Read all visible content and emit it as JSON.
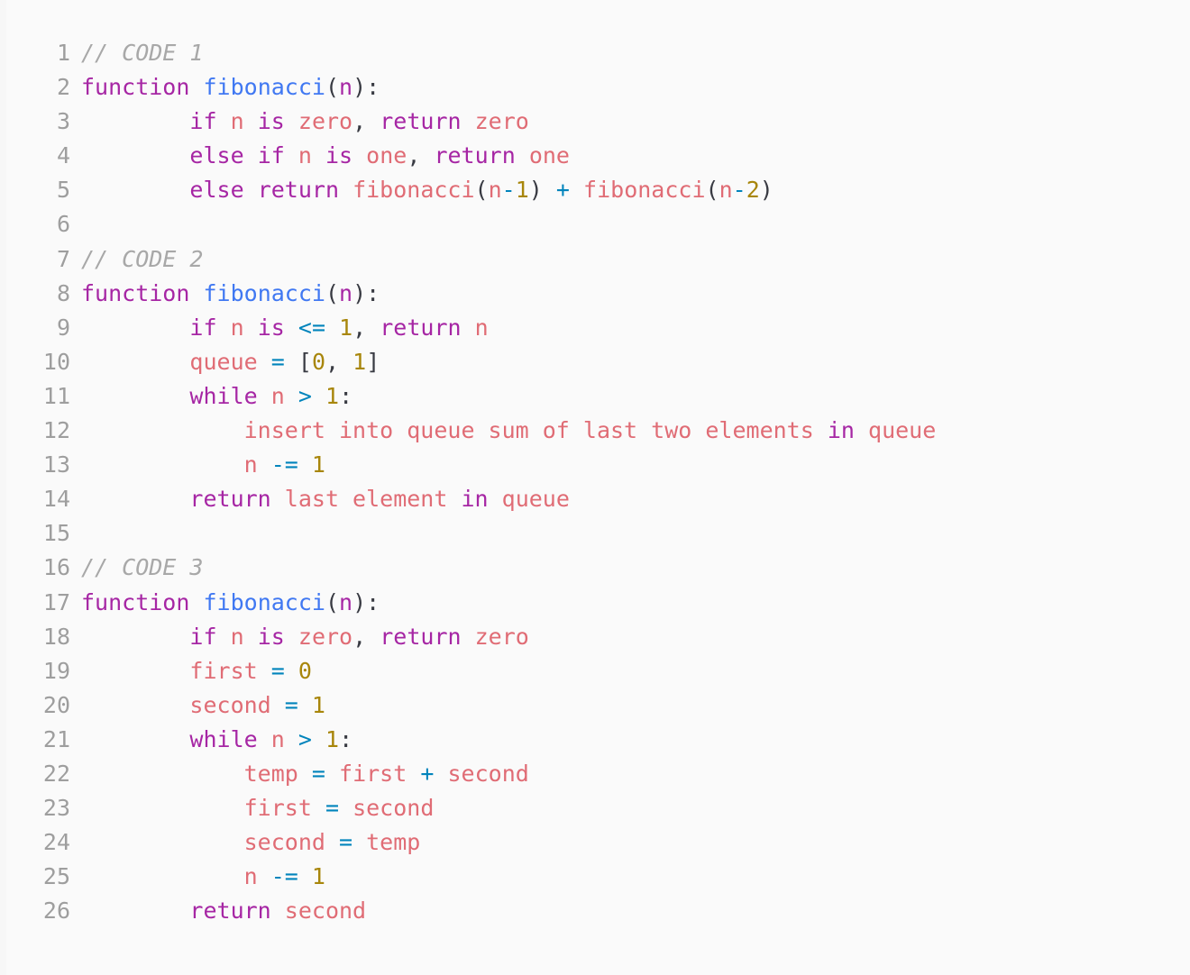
{
  "editor": {
    "background_color": "#fafafa",
    "gutter_color": "#9e9e9e",
    "font_size_px": 25,
    "total_lines": 26
  },
  "colors": {
    "comment": "#a8a8a8",
    "keyword": "#a626a4",
    "function_def": "#4078f2",
    "function_call": "#e06c75",
    "identifier": "#e06c75",
    "operator": "#0184bc",
    "number": "#a8860b",
    "punctuation": "#383a42"
  },
  "code": {
    "lines": [
      {
        "number": "1",
        "tokens": [
          {
            "t": "// CODE 1",
            "c": "comment"
          }
        ]
      },
      {
        "number": "2",
        "tokens": [
          {
            "t": "function",
            "c": "kw"
          },
          {
            "t": " ",
            "c": "plain"
          },
          {
            "t": "fibonacci",
            "c": "fndef"
          },
          {
            "t": "(",
            "c": "punct"
          },
          {
            "t": "n",
            "c": "kw"
          },
          {
            "t": ")",
            "c": "punct"
          },
          {
            "t": ":",
            "c": "punct"
          }
        ]
      },
      {
        "number": "3",
        "tokens": [
          {
            "t": "        ",
            "c": "plain"
          },
          {
            "t": "if",
            "c": "kw"
          },
          {
            "t": " ",
            "c": "plain"
          },
          {
            "t": "n",
            "c": "name"
          },
          {
            "t": " ",
            "c": "plain"
          },
          {
            "t": "is",
            "c": "kw"
          },
          {
            "t": " ",
            "c": "plain"
          },
          {
            "t": "zero",
            "c": "name"
          },
          {
            "t": ",",
            "c": "punct"
          },
          {
            "t": " ",
            "c": "plain"
          },
          {
            "t": "return",
            "c": "kw"
          },
          {
            "t": " ",
            "c": "plain"
          },
          {
            "t": "zero",
            "c": "name"
          }
        ]
      },
      {
        "number": "4",
        "tokens": [
          {
            "t": "        ",
            "c": "plain"
          },
          {
            "t": "else",
            "c": "kw"
          },
          {
            "t": " ",
            "c": "plain"
          },
          {
            "t": "if",
            "c": "kw"
          },
          {
            "t": " ",
            "c": "plain"
          },
          {
            "t": "n",
            "c": "name"
          },
          {
            "t": " ",
            "c": "plain"
          },
          {
            "t": "is",
            "c": "kw"
          },
          {
            "t": " ",
            "c": "plain"
          },
          {
            "t": "one",
            "c": "name"
          },
          {
            "t": ",",
            "c": "punct"
          },
          {
            "t": " ",
            "c": "plain"
          },
          {
            "t": "return",
            "c": "kw"
          },
          {
            "t": " ",
            "c": "plain"
          },
          {
            "t": "one",
            "c": "name"
          }
        ]
      },
      {
        "number": "5",
        "tokens": [
          {
            "t": "        ",
            "c": "plain"
          },
          {
            "t": "else",
            "c": "kw"
          },
          {
            "t": " ",
            "c": "plain"
          },
          {
            "t": "return",
            "c": "kw"
          },
          {
            "t": " ",
            "c": "plain"
          },
          {
            "t": "fibonacci",
            "c": "fncall"
          },
          {
            "t": "(",
            "c": "punct"
          },
          {
            "t": "n",
            "c": "name"
          },
          {
            "t": "-",
            "c": "op"
          },
          {
            "t": "1",
            "c": "num"
          },
          {
            "t": ")",
            "c": "punct"
          },
          {
            "t": " ",
            "c": "plain"
          },
          {
            "t": "+",
            "c": "op"
          },
          {
            "t": " ",
            "c": "plain"
          },
          {
            "t": "fibonacci",
            "c": "fncall"
          },
          {
            "t": "(",
            "c": "punct"
          },
          {
            "t": "n",
            "c": "name"
          },
          {
            "t": "-",
            "c": "op"
          },
          {
            "t": "2",
            "c": "num"
          },
          {
            "t": ")",
            "c": "punct"
          }
        ]
      },
      {
        "number": "6",
        "tokens": []
      },
      {
        "number": "7",
        "tokens": [
          {
            "t": "// CODE 2",
            "c": "comment"
          }
        ]
      },
      {
        "number": "8",
        "tokens": [
          {
            "t": "function",
            "c": "kw"
          },
          {
            "t": " ",
            "c": "plain"
          },
          {
            "t": "fibonacci",
            "c": "fndef"
          },
          {
            "t": "(",
            "c": "punct"
          },
          {
            "t": "n",
            "c": "kw"
          },
          {
            "t": ")",
            "c": "punct"
          },
          {
            "t": ":",
            "c": "punct"
          }
        ]
      },
      {
        "number": "9",
        "tokens": [
          {
            "t": "        ",
            "c": "plain"
          },
          {
            "t": "if",
            "c": "kw"
          },
          {
            "t": " ",
            "c": "plain"
          },
          {
            "t": "n",
            "c": "name"
          },
          {
            "t": " ",
            "c": "plain"
          },
          {
            "t": "is",
            "c": "kw"
          },
          {
            "t": " ",
            "c": "plain"
          },
          {
            "t": "<=",
            "c": "op"
          },
          {
            "t": " ",
            "c": "plain"
          },
          {
            "t": "1",
            "c": "num"
          },
          {
            "t": ",",
            "c": "punct"
          },
          {
            "t": " ",
            "c": "plain"
          },
          {
            "t": "return",
            "c": "kw"
          },
          {
            "t": " ",
            "c": "plain"
          },
          {
            "t": "n",
            "c": "name"
          }
        ]
      },
      {
        "number": "10",
        "tokens": [
          {
            "t": "        ",
            "c": "plain"
          },
          {
            "t": "queue",
            "c": "name"
          },
          {
            "t": " ",
            "c": "plain"
          },
          {
            "t": "=",
            "c": "op"
          },
          {
            "t": " ",
            "c": "plain"
          },
          {
            "t": "[",
            "c": "punct"
          },
          {
            "t": "0",
            "c": "num"
          },
          {
            "t": ",",
            "c": "punct"
          },
          {
            "t": " ",
            "c": "plain"
          },
          {
            "t": "1",
            "c": "num"
          },
          {
            "t": "]",
            "c": "punct"
          }
        ]
      },
      {
        "number": "11",
        "tokens": [
          {
            "t": "        ",
            "c": "plain"
          },
          {
            "t": "while",
            "c": "kw"
          },
          {
            "t": " ",
            "c": "plain"
          },
          {
            "t": "n",
            "c": "name"
          },
          {
            "t": " ",
            "c": "plain"
          },
          {
            "t": ">",
            "c": "op"
          },
          {
            "t": " ",
            "c": "plain"
          },
          {
            "t": "1",
            "c": "num"
          },
          {
            "t": ":",
            "c": "punct"
          }
        ]
      },
      {
        "number": "12",
        "tokens": [
          {
            "t": "            ",
            "c": "plain"
          },
          {
            "t": "insert into queue sum of last two elements",
            "c": "name"
          },
          {
            "t": " ",
            "c": "plain"
          },
          {
            "t": "in",
            "c": "kw"
          },
          {
            "t": " ",
            "c": "plain"
          },
          {
            "t": "queue",
            "c": "name"
          }
        ]
      },
      {
        "number": "13",
        "tokens": [
          {
            "t": "            ",
            "c": "plain"
          },
          {
            "t": "n",
            "c": "name"
          },
          {
            "t": " ",
            "c": "plain"
          },
          {
            "t": "-=",
            "c": "op"
          },
          {
            "t": " ",
            "c": "plain"
          },
          {
            "t": "1",
            "c": "num"
          }
        ]
      },
      {
        "number": "14",
        "tokens": [
          {
            "t": "        ",
            "c": "plain"
          },
          {
            "t": "return",
            "c": "kw"
          },
          {
            "t": " ",
            "c": "plain"
          },
          {
            "t": "last element",
            "c": "name"
          },
          {
            "t": " ",
            "c": "plain"
          },
          {
            "t": "in",
            "c": "kw"
          },
          {
            "t": " ",
            "c": "plain"
          },
          {
            "t": "queue",
            "c": "name"
          }
        ]
      },
      {
        "number": "15",
        "tokens": []
      },
      {
        "number": "16",
        "tokens": [
          {
            "t": "// CODE 3",
            "c": "comment"
          }
        ]
      },
      {
        "number": "17",
        "tokens": [
          {
            "t": "function",
            "c": "kw"
          },
          {
            "t": " ",
            "c": "plain"
          },
          {
            "t": "fibonacci",
            "c": "fndef"
          },
          {
            "t": "(",
            "c": "punct"
          },
          {
            "t": "n",
            "c": "kw"
          },
          {
            "t": ")",
            "c": "punct"
          },
          {
            "t": ":",
            "c": "punct"
          }
        ]
      },
      {
        "number": "18",
        "tokens": [
          {
            "t": "        ",
            "c": "plain"
          },
          {
            "t": "if",
            "c": "kw"
          },
          {
            "t": " ",
            "c": "plain"
          },
          {
            "t": "n",
            "c": "name"
          },
          {
            "t": " ",
            "c": "plain"
          },
          {
            "t": "is",
            "c": "kw"
          },
          {
            "t": " ",
            "c": "plain"
          },
          {
            "t": "zero",
            "c": "name"
          },
          {
            "t": ",",
            "c": "punct"
          },
          {
            "t": " ",
            "c": "plain"
          },
          {
            "t": "return",
            "c": "kw"
          },
          {
            "t": " ",
            "c": "plain"
          },
          {
            "t": "zero",
            "c": "name"
          }
        ]
      },
      {
        "number": "19",
        "tokens": [
          {
            "t": "        ",
            "c": "plain"
          },
          {
            "t": "first",
            "c": "name"
          },
          {
            "t": " ",
            "c": "plain"
          },
          {
            "t": "=",
            "c": "op"
          },
          {
            "t": " ",
            "c": "plain"
          },
          {
            "t": "0",
            "c": "num"
          }
        ]
      },
      {
        "number": "20",
        "tokens": [
          {
            "t": "        ",
            "c": "plain"
          },
          {
            "t": "second",
            "c": "name"
          },
          {
            "t": " ",
            "c": "plain"
          },
          {
            "t": "=",
            "c": "op"
          },
          {
            "t": " ",
            "c": "plain"
          },
          {
            "t": "1",
            "c": "num"
          }
        ]
      },
      {
        "number": "21",
        "tokens": [
          {
            "t": "        ",
            "c": "plain"
          },
          {
            "t": "while",
            "c": "kw"
          },
          {
            "t": " ",
            "c": "plain"
          },
          {
            "t": "n",
            "c": "name"
          },
          {
            "t": " ",
            "c": "plain"
          },
          {
            "t": ">",
            "c": "op"
          },
          {
            "t": " ",
            "c": "plain"
          },
          {
            "t": "1",
            "c": "num"
          },
          {
            "t": ":",
            "c": "punct"
          }
        ]
      },
      {
        "number": "22",
        "tokens": [
          {
            "t": "            ",
            "c": "plain"
          },
          {
            "t": "temp",
            "c": "name"
          },
          {
            "t": " ",
            "c": "plain"
          },
          {
            "t": "=",
            "c": "op"
          },
          {
            "t": " ",
            "c": "plain"
          },
          {
            "t": "first",
            "c": "name"
          },
          {
            "t": " ",
            "c": "plain"
          },
          {
            "t": "+",
            "c": "op"
          },
          {
            "t": " ",
            "c": "plain"
          },
          {
            "t": "second",
            "c": "name"
          }
        ]
      },
      {
        "number": "23",
        "tokens": [
          {
            "t": "            ",
            "c": "plain"
          },
          {
            "t": "first",
            "c": "name"
          },
          {
            "t": " ",
            "c": "plain"
          },
          {
            "t": "=",
            "c": "op"
          },
          {
            "t": " ",
            "c": "plain"
          },
          {
            "t": "second",
            "c": "name"
          }
        ]
      },
      {
        "number": "24",
        "tokens": [
          {
            "t": "            ",
            "c": "plain"
          },
          {
            "t": "second",
            "c": "name"
          },
          {
            "t": " ",
            "c": "plain"
          },
          {
            "t": "=",
            "c": "op"
          },
          {
            "t": " ",
            "c": "plain"
          },
          {
            "t": "temp",
            "c": "name"
          }
        ]
      },
      {
        "number": "25",
        "tokens": [
          {
            "t": "            ",
            "c": "plain"
          },
          {
            "t": "n",
            "c": "name"
          },
          {
            "t": " ",
            "c": "plain"
          },
          {
            "t": "-=",
            "c": "op"
          },
          {
            "t": " ",
            "c": "plain"
          },
          {
            "t": "1",
            "c": "num"
          }
        ]
      },
      {
        "number": "26",
        "tokens": [
          {
            "t": "        ",
            "c": "plain"
          },
          {
            "t": "return",
            "c": "kw"
          },
          {
            "t": " ",
            "c": "plain"
          },
          {
            "t": "second",
            "c": "name"
          }
        ]
      }
    ]
  }
}
